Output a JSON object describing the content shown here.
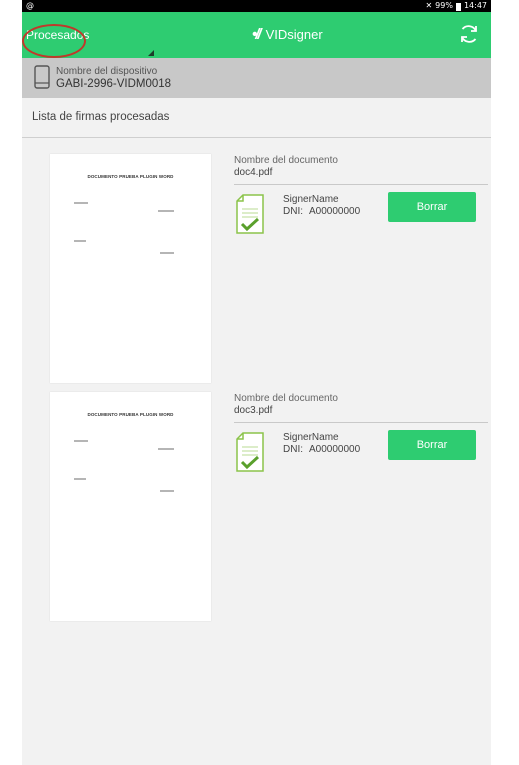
{
  "statusbar": {
    "left_icon": "@",
    "mute_icon": "🔇",
    "battery_text": "99%",
    "time": "14:47"
  },
  "appbar": {
    "menu_label": "Procesados",
    "brand_mark": "•//",
    "brand_name": "VIDsigner"
  },
  "device": {
    "label": "Nombre del dispositivo",
    "value": "GABI-2996-VIDM0018"
  },
  "section_title": "Lista de firmas procesadas",
  "documents": [
    {
      "thumb_title": "DOCUMENTO PRUEBA PLUGIN WORD",
      "doc_label": "Nombre del documento",
      "doc_name": "doc4.pdf",
      "signer_name": "SignerName",
      "dni_label": "DNI:",
      "dni_value": "A00000000",
      "delete_label": "Borrar"
    },
    {
      "thumb_title": "DOCUMENTO PRUEBA PLUGIN WORD",
      "doc_label": "Nombre del documento",
      "doc_name": "doc3.pdf",
      "signer_name": "SignerName",
      "dni_label": "DNI:",
      "dni_value": "A00000000",
      "delete_label": "Borrar"
    }
  ],
  "colors": {
    "accent": "#2ecc71",
    "device_bar": "#c8c8c8",
    "highlight_circle": "#c0392b"
  },
  "icons": {
    "sync": "sync-icon",
    "phone": "phone-icon",
    "signed_doc": "signed-document-icon"
  }
}
